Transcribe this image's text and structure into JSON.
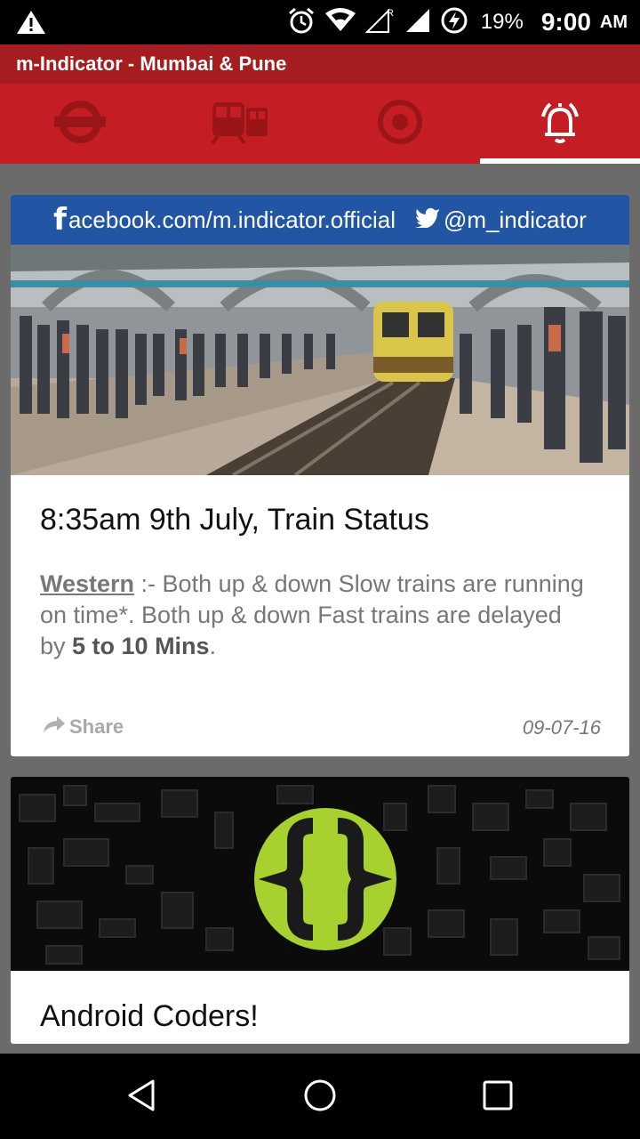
{
  "status_bar": {
    "battery_percent": "19%",
    "time": "9:00",
    "ampm": "AM",
    "roaming": "R"
  },
  "app": {
    "title": "m-Indicator - Mumbai & Pune"
  },
  "tabs": [
    {
      "icon": "metro-icon",
      "selected": false
    },
    {
      "icon": "train-icon",
      "selected": false
    },
    {
      "icon": "target-icon",
      "selected": false
    },
    {
      "icon": "alarm-bell-icon",
      "selected": true
    }
  ],
  "feed": {
    "card1": {
      "banner_fb_letter": "f",
      "banner_fb": "acebook.com/m.indicator.official",
      "banner_twitter": "@m_indicator",
      "headline": "8:35am 9th July, Train Status",
      "body_line_label": "Western",
      "body_part1": " :- Both up & down Slow trains are running on time*. Both up & down Fast trains are delayed by ",
      "body_bold": "5 to 10 Mins",
      "body_end": ".",
      "share_label": "Share",
      "date": "09-07-16"
    },
    "card2": {
      "title": "Android Coders!"
    }
  },
  "colors": {
    "title_bar": "#a51d1f",
    "tab_bar": "#c41e24",
    "tab_icon_inactive": "#9a1518",
    "twitter_banner": "#2255a4",
    "logo_green": "#a6d12e"
  }
}
